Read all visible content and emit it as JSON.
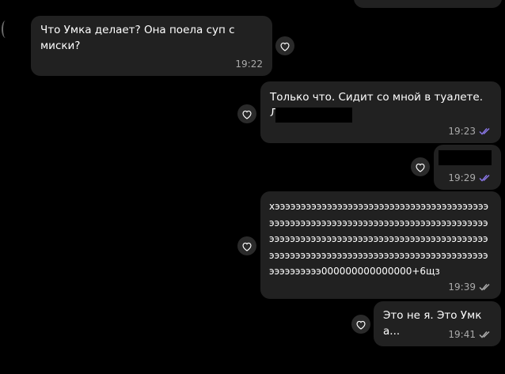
{
  "colors": {
    "background": "#000000",
    "bubble": "#212121",
    "text": "#ffffff",
    "meta_text": "#aaaaaa",
    "read_check": "#8774e1",
    "sent_check": "#aaaaaa"
  },
  "messages": [
    {
      "direction": "incoming",
      "text": "Что Умка делает? Она поела суп с миски?",
      "time": "19:22",
      "check_icon": "none"
    },
    {
      "direction": "outgoing",
      "text": "Только что. Сидит со мной в туалете.\nЛ",
      "time": "19:23",
      "check_icon": "double-check-read-icon"
    },
    {
      "direction": "outgoing",
      "text": "",
      "time": "19:29",
      "check_icon": "double-check-read-icon"
    },
    {
      "direction": "outgoing",
      "text": "хэээээээээээээээээээээээээээээээээээээээээээээээээээээээээээээээээээээээээээээээээээээээээээээээээээээээээээээээээээээээээээээээээээээээээээээээээээээээээээээээээээээээээээээээээ000000000000000+6щз",
      "time": "19:39",
      "check_icon": "double-check-sent-icon"
    },
    {
      "direction": "outgoing",
      "text": "Это не я. Это Умка...",
      "time": "19:41",
      "check_icon": "double-check-sent-icon"
    }
  ],
  "reaction_icon": "heart-outline-icon"
}
